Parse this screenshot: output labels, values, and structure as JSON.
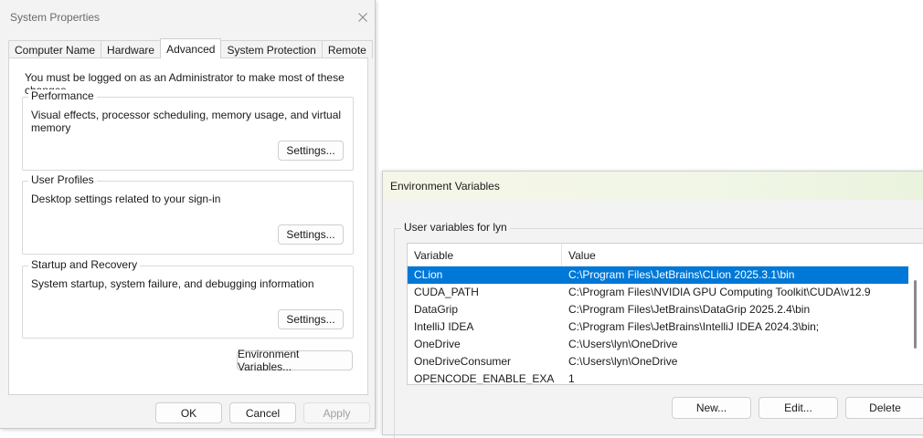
{
  "system_properties": {
    "title": "System Properties",
    "close_icon": "close-icon",
    "tabs": [
      {
        "label": "Computer Name",
        "active": false
      },
      {
        "label": "Hardware",
        "active": false
      },
      {
        "label": "Advanced",
        "active": true
      },
      {
        "label": "System Protection",
        "active": false
      },
      {
        "label": "Remote",
        "active": false
      }
    ],
    "admin_note": "You must be logged on as an Administrator to make most of these changes.",
    "groups": [
      {
        "title": "Performance",
        "description": "Visual effects, processor scheduling, memory usage, and virtual memory",
        "button": "Settings..."
      },
      {
        "title": "User Profiles",
        "description": "Desktop settings related to your sign-in",
        "button": "Settings..."
      },
      {
        "title": "Startup and Recovery",
        "description": "System startup, system failure, and debugging information",
        "button": "Settings..."
      }
    ],
    "env_vars_button": "Environment Variables...",
    "footer": {
      "ok": "OK",
      "cancel": "Cancel",
      "apply": "Apply"
    }
  },
  "environment_variables": {
    "title": "Environment Variables",
    "user_group_title": "User variables for lyn",
    "columns": {
      "variable": "Variable",
      "value": "Value"
    },
    "rows": [
      {
        "variable": "CLion",
        "value": "C:\\Program Files\\JetBrains\\CLion 2025.3.1\\bin",
        "selected": true
      },
      {
        "variable": "CUDA_PATH",
        "value": "C:\\Program Files\\NVIDIA GPU Computing Toolkit\\CUDA\\v12.9",
        "selected": false
      },
      {
        "variable": "DataGrip",
        "value": "C:\\Program Files\\JetBrains\\DataGrip 2025.2.4\\bin",
        "selected": false
      },
      {
        "variable": "IntelliJ IDEA",
        "value": "C:\\Program Files\\JetBrains\\IntelliJ IDEA 2024.3\\bin;",
        "selected": false
      },
      {
        "variable": "OneDrive",
        "value": "C:\\Users\\lyn\\OneDrive",
        "selected": false
      },
      {
        "variable": "OneDriveConsumer",
        "value": "C:\\Users\\lyn\\OneDrive",
        "selected": false
      },
      {
        "variable": "OPENCODE_ENABLE_EXA",
        "value": "1",
        "selected": false
      }
    ],
    "buttons": {
      "new": "New...",
      "edit": "Edit...",
      "delete": "Delete"
    }
  },
  "colors": {
    "selection": "#0078d7",
    "window_bg": "#f3f3f3",
    "panel_bg": "#ffffff"
  }
}
